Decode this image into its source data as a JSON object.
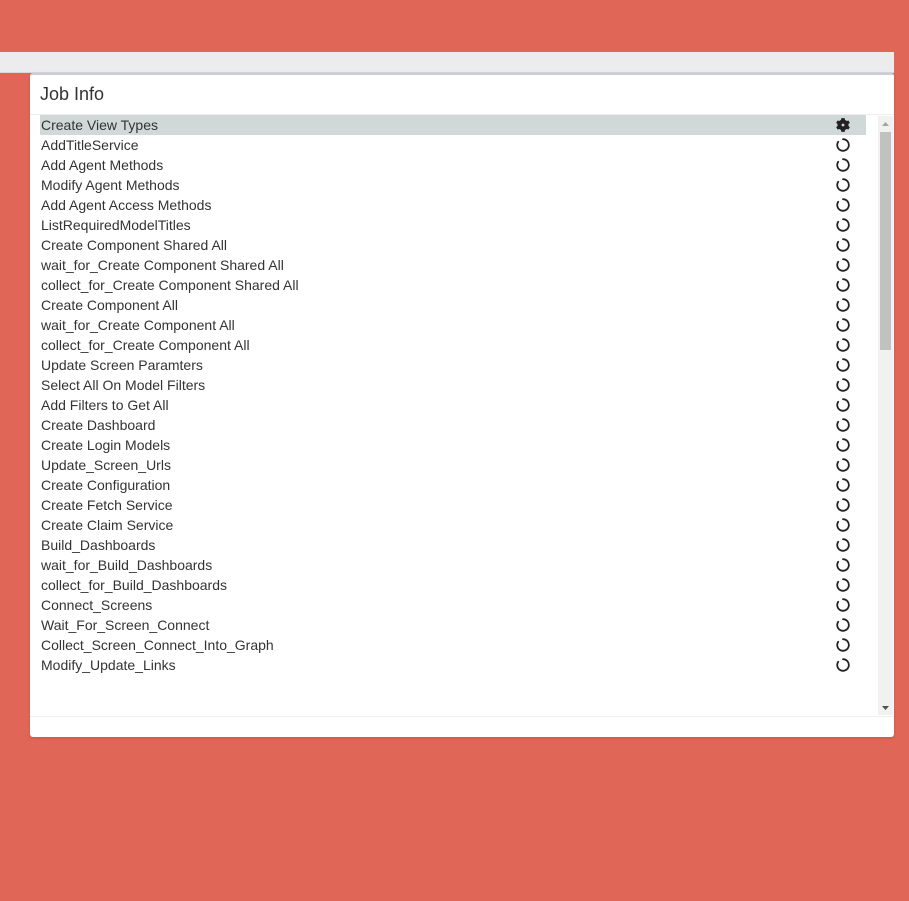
{
  "modal": {
    "title": "Job Info"
  },
  "jobs": [
    {
      "name": "Create View Types",
      "status": "running",
      "icon": "gear-icon"
    },
    {
      "name": "AddTitleService",
      "status": "pending",
      "icon": "spinner-circle-icon"
    },
    {
      "name": "Add Agent Methods",
      "status": "pending",
      "icon": "spinner-circle-icon"
    },
    {
      "name": "Modify Agent Methods",
      "status": "pending",
      "icon": "spinner-circle-icon"
    },
    {
      "name": "Add Agent Access Methods",
      "status": "pending",
      "icon": "spinner-circle-icon"
    },
    {
      "name": "ListRequiredModelTitles",
      "status": "pending",
      "icon": "spinner-circle-icon"
    },
    {
      "name": "Create Component Shared All",
      "status": "pending",
      "icon": "spinner-circle-icon"
    },
    {
      "name": "wait_for_Create Component Shared All",
      "status": "pending",
      "icon": "spinner-circle-icon"
    },
    {
      "name": "collect_for_Create Component Shared All",
      "status": "pending",
      "icon": "spinner-circle-icon"
    },
    {
      "name": "Create Component All",
      "status": "pending",
      "icon": "spinner-circle-icon"
    },
    {
      "name": "wait_for_Create Component All",
      "status": "pending",
      "icon": "spinner-circle-icon"
    },
    {
      "name": "collect_for_Create Component All",
      "status": "pending",
      "icon": "spinner-circle-icon"
    },
    {
      "name": "Update Screen Paramters",
      "status": "pending",
      "icon": "spinner-circle-icon"
    },
    {
      "name": "Select All On Model Filters",
      "status": "pending",
      "icon": "spinner-circle-icon"
    },
    {
      "name": "Add Filters to Get All",
      "status": "pending",
      "icon": "spinner-circle-icon"
    },
    {
      "name": "Create Dashboard",
      "status": "pending",
      "icon": "spinner-circle-icon"
    },
    {
      "name": "Create Login Models",
      "status": "pending",
      "icon": "spinner-circle-icon"
    },
    {
      "name": "Update_Screen_Urls",
      "status": "pending",
      "icon": "spinner-circle-icon"
    },
    {
      "name": "Create Configuration",
      "status": "pending",
      "icon": "spinner-circle-icon"
    },
    {
      "name": "Create Fetch Service",
      "status": "pending",
      "icon": "spinner-circle-icon"
    },
    {
      "name": "Create Claim Service",
      "status": "pending",
      "icon": "spinner-circle-icon"
    },
    {
      "name": "Build_Dashboards",
      "status": "pending",
      "icon": "spinner-circle-icon"
    },
    {
      "name": "wait_for_Build_Dashboards",
      "status": "pending",
      "icon": "spinner-circle-icon"
    },
    {
      "name": "collect_for_Build_Dashboards",
      "status": "pending",
      "icon": "spinner-circle-icon"
    },
    {
      "name": "Connect_Screens",
      "status": "pending",
      "icon": "spinner-circle-icon"
    },
    {
      "name": "Wait_For_Screen_Connect",
      "status": "pending",
      "icon": "spinner-circle-icon"
    },
    {
      "name": "Collect_Screen_Connect_Into_Graph",
      "status": "pending",
      "icon": "spinner-circle-icon"
    },
    {
      "name": "Modify_Update_Links",
      "status": "pending",
      "icon": "spinner-circle-icon"
    }
  ],
  "colors": {
    "background": "#e06758",
    "active_row": "#d0d8d8",
    "text": "#333333",
    "icon": "#222222"
  },
  "scroll": {
    "position_fraction": 0.0
  }
}
